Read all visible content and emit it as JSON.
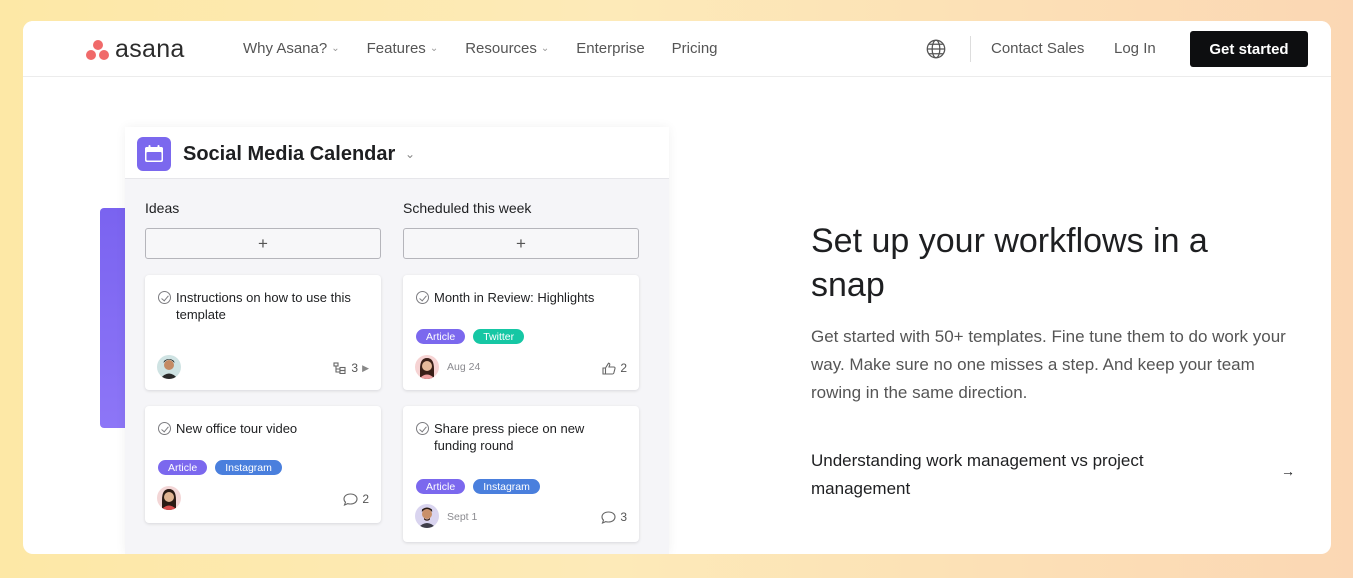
{
  "nav": {
    "logo_text": "asana",
    "links": [
      {
        "label": "Why Asana?",
        "dropdown": true
      },
      {
        "label": "Features",
        "dropdown": true
      },
      {
        "label": "Resources",
        "dropdown": true
      },
      {
        "label": "Enterprise",
        "dropdown": false
      },
      {
        "label": "Pricing",
        "dropdown": false
      }
    ],
    "globe_icon": "globe-icon",
    "contact_sales": "Contact Sales",
    "log_in": "Log In",
    "get_started": "Get started"
  },
  "board": {
    "title": "Social Media Calendar",
    "columns": [
      {
        "title": "Ideas",
        "add_label": "+",
        "cards": [
          {
            "title": "Instructions on how to use this template",
            "tags": [],
            "subtasks": "3"
          },
          {
            "title": "New office tour video",
            "tags": [
              "Article",
              "Instagram"
            ],
            "comments": "2"
          }
        ]
      },
      {
        "title": "Scheduled this week",
        "add_label": "+",
        "cards": [
          {
            "title": "Month in Review: Highlights",
            "tags": [
              "Article",
              "Twitter"
            ],
            "date": "Aug 24",
            "likes": "2"
          },
          {
            "title": "Share press piece on new funding round",
            "tags": [
              "Article",
              "Instagram"
            ],
            "date": "Sept 1",
            "comments": "3"
          }
        ]
      }
    ]
  },
  "content": {
    "headline": "Set up your workflows in a snap",
    "description": "Get started with 50+ templates. Fine tune them to do work your way. Make sure no one misses a step. And keep your team rowing in the same direction.",
    "link_text": "Understanding work management vs project management",
    "arrow": "→"
  },
  "colors": {
    "brand_coral": "#f06a6a",
    "tag_article": "#7b68ee",
    "tag_twitter": "#16c7a4",
    "tag_instagram": "#4a7fdd",
    "cta_bg": "#0d0e10"
  }
}
